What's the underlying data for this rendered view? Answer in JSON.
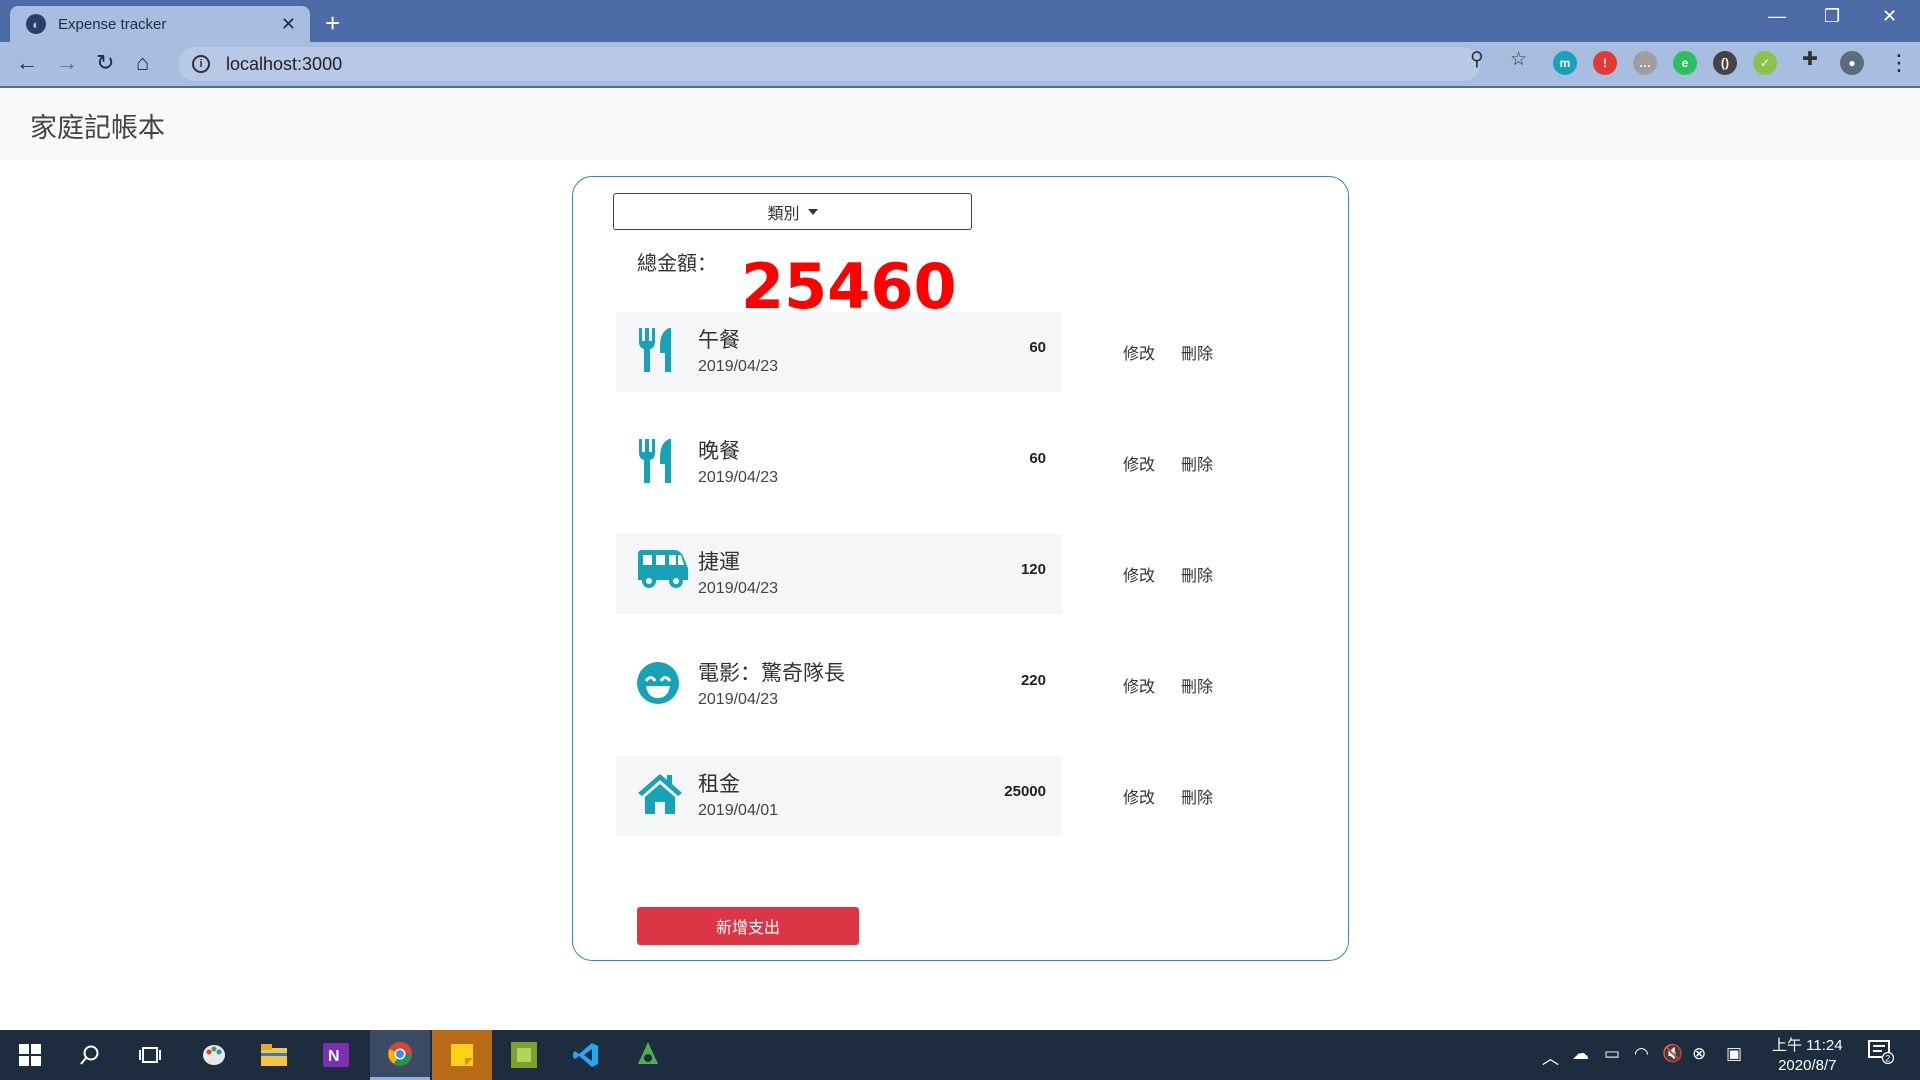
{
  "browser": {
    "tab_title": "Expense tracker",
    "tab_close": "✕",
    "new_tab": "+",
    "url": "localhost:3000",
    "window_controls": {
      "minimize": "—",
      "restore": "❐",
      "close": "✕"
    },
    "extensions": [
      {
        "name": "m-extension",
        "label": "m",
        "color": "#17a2b8"
      },
      {
        "name": "red-extension",
        "label": "!",
        "color": "#e53935"
      },
      {
        "name": "chat-extension",
        "label": "…",
        "color": "#9e9e9e"
      },
      {
        "name": "evernote-extension",
        "label": "e",
        "color": "#2dbe60"
      },
      {
        "name": "bracket-extension",
        "label": "()",
        "color": "#444444"
      },
      {
        "name": "check-extension",
        "label": "✓",
        "color": "#8bc34a"
      }
    ]
  },
  "navbar": {
    "brand": "家庭記帳本"
  },
  "filter": {
    "label": "類別"
  },
  "summary": {
    "label": "總金額：",
    "total": "25460"
  },
  "records": [
    {
      "icon": "utensils-icon",
      "name": "午餐",
      "date": "2019/04/23",
      "amount": "60",
      "shaded": true
    },
    {
      "icon": "utensils-icon",
      "name": "晚餐",
      "date": "2019/04/23",
      "amount": "60",
      "shaded": false
    },
    {
      "icon": "bus-icon",
      "name": "捷運",
      "date": "2019/04/23",
      "amount": "120",
      "shaded": true
    },
    {
      "icon": "smile-icon",
      "name": "電影：驚奇隊長",
      "date": "2019/04/23",
      "amount": "220",
      "shaded": false
    },
    {
      "icon": "home-icon",
      "name": "租金",
      "date": "2019/04/01",
      "amount": "25000",
      "shaded": true
    }
  ],
  "actions": {
    "edit": "修改",
    "delete": "刪除"
  },
  "add_button": "新增支出",
  "taskbar": {
    "time": "上午 11:24",
    "date": "2020/8/7",
    "notification_count": "2"
  },
  "colors": {
    "accent": "#17a2b8",
    "total": "#ff0000",
    "danger": "#dc3545",
    "card_border": "#2f86d6"
  }
}
